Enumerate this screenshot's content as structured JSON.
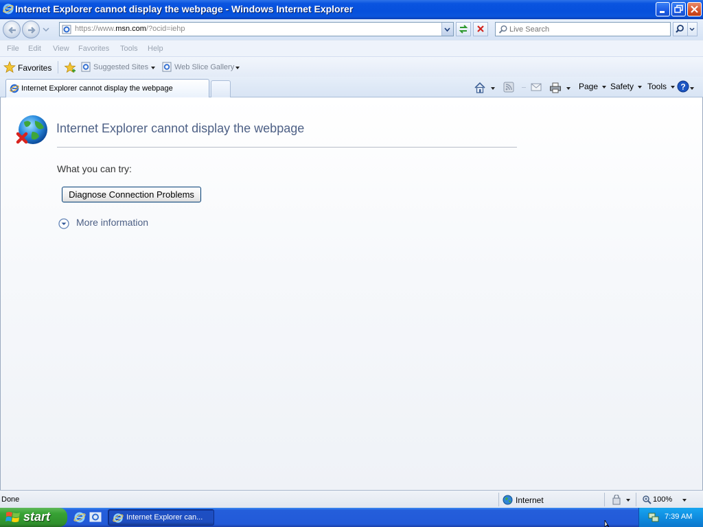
{
  "window": {
    "title": "Internet Explorer cannot display the webpage - Windows Internet Explorer"
  },
  "address": {
    "url_prefix": "https://www.",
    "url_host": "msn.com",
    "url_suffix": "/?ocid=iehp",
    "search_placeholder": "Live Search"
  },
  "menu": {
    "items": [
      "File",
      "Edit",
      "View",
      "Favorites",
      "Tools",
      "Help"
    ]
  },
  "favorites_bar": {
    "favorites_label": "Favorites",
    "links": [
      "Suggested Sites",
      "Web Slice Gallery"
    ]
  },
  "tabs": {
    "active_tab": "Internet Explorer cannot display the webpage"
  },
  "command_bar": {
    "page_label": "Page",
    "safety_label": "Safety",
    "tools_label": "Tools"
  },
  "content": {
    "heading": "Internet Explorer cannot display the webpage",
    "try_text": "What you can try:",
    "diagnose_button": "Diagnose Connection Problems",
    "more_info_link": "More information"
  },
  "status": {
    "text": "Done",
    "zone": "Internet",
    "zoom": "100%"
  },
  "taskbar": {
    "start_label": "start",
    "task_label": "Internet Explorer can...",
    "clock": "7:39 AM"
  },
  "icons": {
    "app": "ie-icon",
    "back": "back-arrow-icon",
    "forward": "forward-arrow-icon",
    "refresh": "refresh-icon",
    "stop": "stop-icon",
    "search": "search-icon",
    "home": "home-icon",
    "feeds": "feeds-icon",
    "mail": "mail-icon",
    "print": "print-icon",
    "help": "help-icon",
    "error": "globe-error-icon",
    "expand": "chevron-down-circle-icon",
    "zone": "globe-icon",
    "zoom": "magnifier-icon"
  },
  "colors": {
    "titlebar": "#0650dc",
    "heading": "#4d6085",
    "start_green": "#37a234",
    "taskbar_blue": "#245edb"
  }
}
